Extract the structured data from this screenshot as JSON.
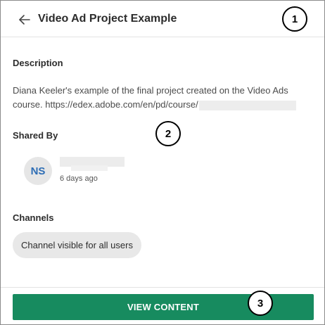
{
  "header": {
    "title": "Video Ad Project Example",
    "back_icon": "arrow-left-icon"
  },
  "callouts": [
    "1",
    "2",
    "3"
  ],
  "description": {
    "label": "Description",
    "line1": "Diana Keeler's example of the final project created on the Video Ads",
    "line2": "course. https://edex.adobe.com/en/pd/course/"
  },
  "shared_by": {
    "label": "Shared By",
    "initials": "NS",
    "time_ago": "6 days ago"
  },
  "channels": {
    "label": "Channels",
    "items": [
      "Channel visible for all users"
    ]
  },
  "footer": {
    "button_label": "VIEW CONTENT"
  },
  "colors": {
    "primary_button": "#178b5f",
    "avatar_initials": "#2d6db5"
  }
}
